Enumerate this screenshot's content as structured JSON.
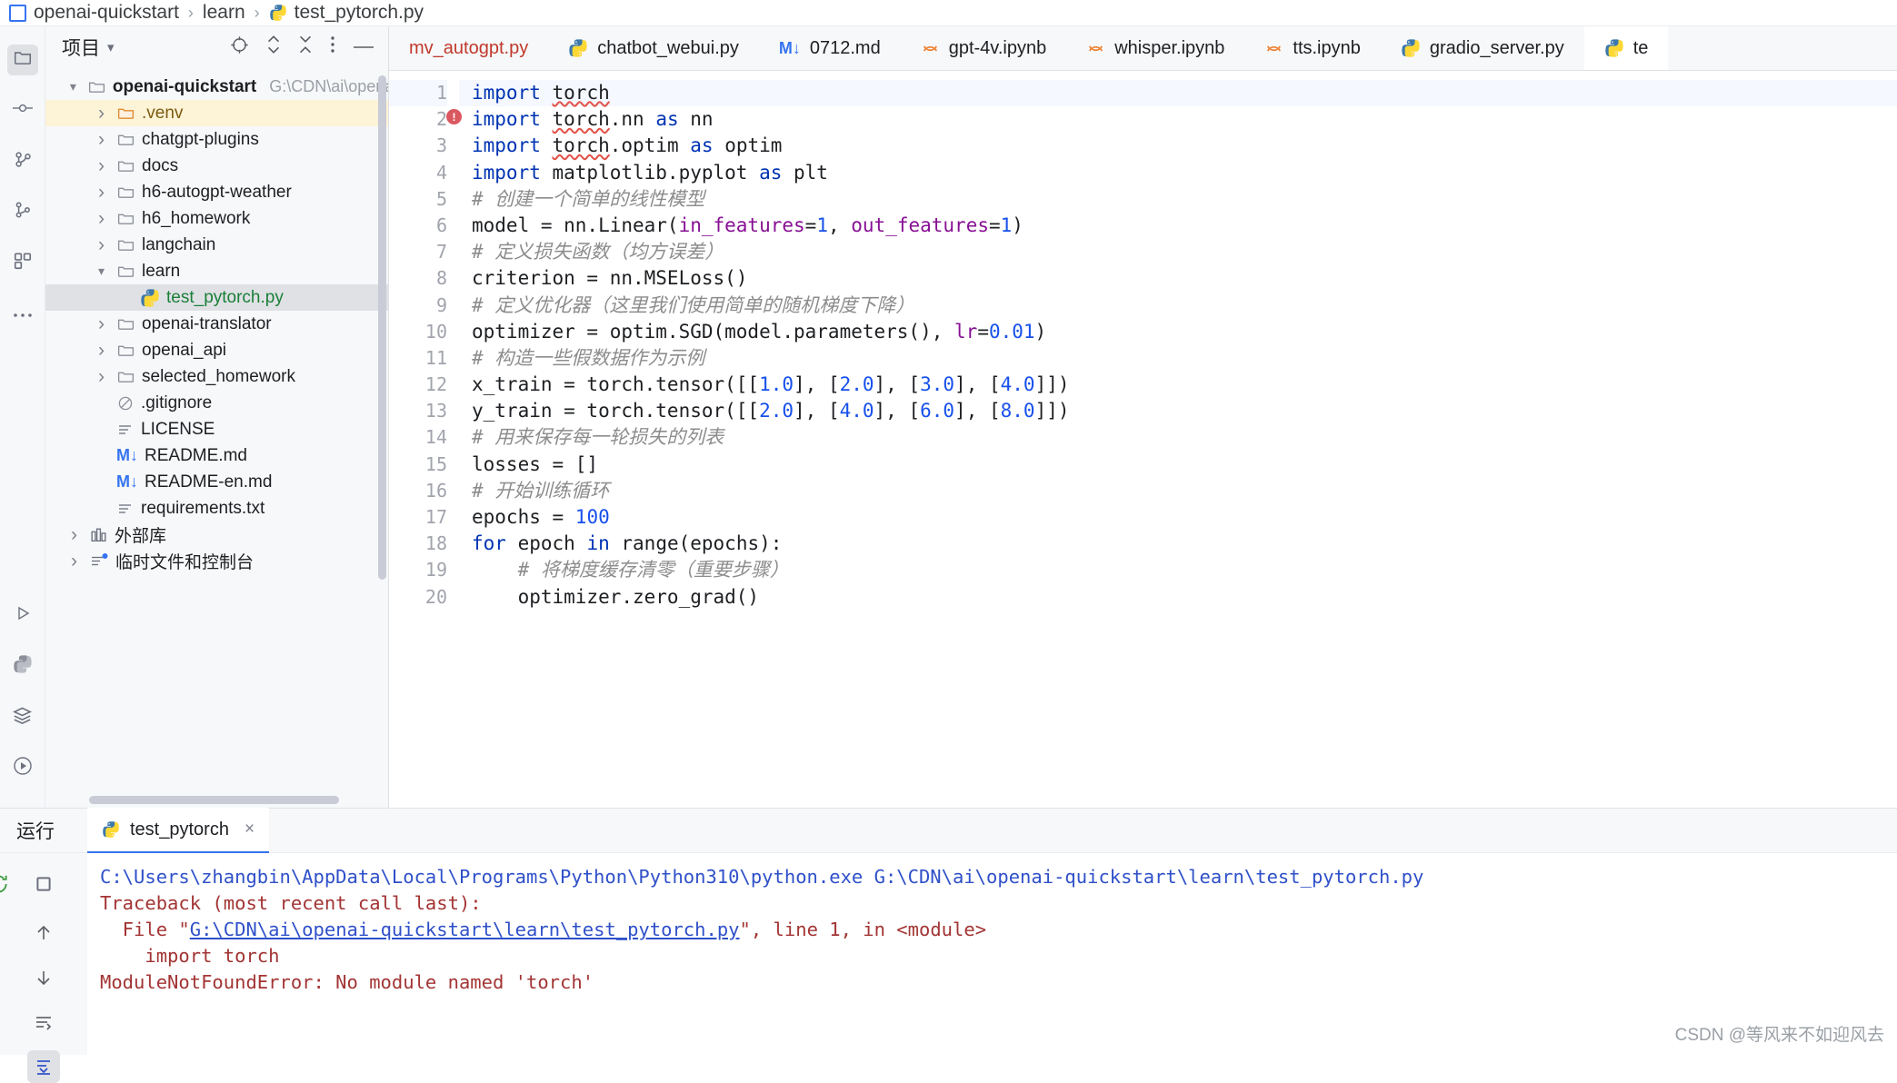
{
  "breadcrumb": {
    "items": [
      "openai-quickstart",
      "learn",
      "test_pytorch.py"
    ],
    "separator": "›"
  },
  "project_panel": {
    "title": "项目",
    "actions": [
      "locate-icon",
      "expand-collapse-icon",
      "collapse-all-icon",
      "more-icon",
      "hide-icon"
    ],
    "tree": [
      {
        "label": "openai-quickstart",
        "path": "G:\\CDN\\ai\\openai-",
        "kind": "folder-root",
        "arrow": "down",
        "indent": 0,
        "state": "expanded",
        "bold": true
      },
      {
        "label": ".venv",
        "path": "",
        "kind": "folder-orange",
        "arrow": "right",
        "indent": 1,
        "state": "highlighted"
      },
      {
        "label": "chatgpt-plugins",
        "path": "",
        "kind": "folder",
        "arrow": "right",
        "indent": 1
      },
      {
        "label": "docs",
        "path": "",
        "kind": "folder",
        "arrow": "right",
        "indent": 1
      },
      {
        "label": "h6-autogpt-weather",
        "path": "",
        "kind": "folder",
        "arrow": "right",
        "indent": 1
      },
      {
        "label": "h6_homework",
        "path": "",
        "kind": "folder",
        "arrow": "right",
        "indent": 1
      },
      {
        "label": "langchain",
        "path": "",
        "kind": "folder",
        "arrow": "right",
        "indent": 1
      },
      {
        "label": "learn",
        "path": "",
        "kind": "folder",
        "arrow": "down",
        "indent": 1,
        "state": "expanded"
      },
      {
        "label": "test_pytorch.py",
        "path": "",
        "kind": "python",
        "arrow": "none",
        "indent": 2,
        "state": "selected"
      },
      {
        "label": "openai-translator",
        "path": "",
        "kind": "folder",
        "arrow": "right",
        "indent": 1
      },
      {
        "label": "openai_api",
        "path": "",
        "kind": "folder",
        "arrow": "right",
        "indent": 1
      },
      {
        "label": "selected_homework",
        "path": "",
        "kind": "folder",
        "arrow": "right",
        "indent": 1
      },
      {
        "label": ".gitignore",
        "path": "",
        "kind": "gitignore",
        "arrow": "none",
        "indent": 1
      },
      {
        "label": "LICENSE",
        "path": "",
        "kind": "text",
        "arrow": "none",
        "indent": 1
      },
      {
        "label": "README.md",
        "path": "",
        "kind": "markdown",
        "arrow": "none",
        "indent": 1
      },
      {
        "label": "README-en.md",
        "path": "",
        "kind": "markdown",
        "arrow": "none",
        "indent": 1
      },
      {
        "label": "requirements.txt",
        "path": "",
        "kind": "text",
        "arrow": "none",
        "indent": 1
      },
      {
        "label": "外部库",
        "path": "",
        "kind": "library",
        "arrow": "right",
        "indent": 0
      },
      {
        "label": "临时文件和控制台",
        "path": "",
        "kind": "scratch",
        "arrow": "right",
        "indent": 0
      }
    ]
  },
  "editor": {
    "tabs": [
      {
        "label": "mv_autogpt.py",
        "icon": "none",
        "color": "red",
        "active": false
      },
      {
        "label": "chatbot_webui.py",
        "icon": "python",
        "color": "normal",
        "active": false
      },
      {
        "label": "0712.md",
        "icon": "markdown",
        "color": "normal",
        "active": false
      },
      {
        "label": "gpt-4v.ipynb",
        "icon": "jupyter",
        "color": "normal",
        "active": false
      },
      {
        "label": "whisper.ipynb",
        "icon": "jupyter",
        "color": "normal",
        "active": false
      },
      {
        "label": "tts.ipynb",
        "icon": "jupyter",
        "color": "normal",
        "active": false
      },
      {
        "label": "gradio_server.py",
        "icon": "python",
        "color": "normal",
        "active": false
      },
      {
        "label": "te",
        "icon": "python",
        "color": "normal",
        "active": true
      }
    ],
    "line_numbers": [
      1,
      2,
      3,
      4,
      5,
      6,
      7,
      8,
      9,
      10,
      11,
      12,
      13,
      14,
      15,
      16,
      17,
      18,
      19,
      20
    ],
    "lines": [
      [
        {
          "t": "import",
          "c": "kw"
        },
        {
          "t": " ",
          "c": "id"
        },
        {
          "t": "torch",
          "c": "err"
        }
      ],
      [
        {
          "t": "import",
          "c": "kw"
        },
        {
          "t": " ",
          "c": "id"
        },
        {
          "t": "torch",
          "c": "err"
        },
        {
          "t": ".nn ",
          "c": "id"
        },
        {
          "t": "as",
          "c": "kw"
        },
        {
          "t": " nn",
          "c": "id"
        }
      ],
      [
        {
          "t": "import",
          "c": "kw"
        },
        {
          "t": " ",
          "c": "id"
        },
        {
          "t": "torch",
          "c": "err"
        },
        {
          "t": ".optim ",
          "c": "id"
        },
        {
          "t": "as",
          "c": "kw"
        },
        {
          "t": " optim",
          "c": "id"
        }
      ],
      [
        {
          "t": "import",
          "c": "kw"
        },
        {
          "t": " matplotlib.pyplot ",
          "c": "id"
        },
        {
          "t": "as",
          "c": "kw"
        },
        {
          "t": " plt",
          "c": "id"
        }
      ],
      [
        {
          "t": "# 创建一个简单的线性模型",
          "c": "cmt"
        }
      ],
      [
        {
          "t": "model = nn.Linear(",
          "c": "id"
        },
        {
          "t": "in_features",
          "c": "kwarg"
        },
        {
          "t": "=",
          "c": "id"
        },
        {
          "t": "1",
          "c": "num"
        },
        {
          "t": ", ",
          "c": "id"
        },
        {
          "t": "out_features",
          "c": "kwarg"
        },
        {
          "t": "=",
          "c": "id"
        },
        {
          "t": "1",
          "c": "num"
        },
        {
          "t": ")",
          "c": "id"
        }
      ],
      [
        {
          "t": "# 定义损失函数（均方误差）",
          "c": "cmt"
        }
      ],
      [
        {
          "t": "criterion = nn.MSELoss()",
          "c": "id"
        }
      ],
      [
        {
          "t": "# 定义优化器（这里我们使用简单的随机梯度下降）",
          "c": "cmt"
        }
      ],
      [
        {
          "t": "optimizer = optim.SGD(model.parameters(), ",
          "c": "id"
        },
        {
          "t": "lr",
          "c": "kwarg"
        },
        {
          "t": "=",
          "c": "id"
        },
        {
          "t": "0.01",
          "c": "num"
        },
        {
          "t": ")",
          "c": "id"
        }
      ],
      [
        {
          "t": "# 构造一些假数据作为示例",
          "c": "cmt"
        }
      ],
      [
        {
          "t": "x_train = torch.tensor([[",
          "c": "id"
        },
        {
          "t": "1.0",
          "c": "num"
        },
        {
          "t": "], [",
          "c": "id"
        },
        {
          "t": "2.0",
          "c": "num"
        },
        {
          "t": "], [",
          "c": "id"
        },
        {
          "t": "3.0",
          "c": "num"
        },
        {
          "t": "], [",
          "c": "id"
        },
        {
          "t": "4.0",
          "c": "num"
        },
        {
          "t": "]])",
          "c": "id"
        }
      ],
      [
        {
          "t": "y_train = torch.tensor([[",
          "c": "id"
        },
        {
          "t": "2.0",
          "c": "num"
        },
        {
          "t": "], [",
          "c": "id"
        },
        {
          "t": "4.0",
          "c": "num"
        },
        {
          "t": "], [",
          "c": "id"
        },
        {
          "t": "6.0",
          "c": "num"
        },
        {
          "t": "], [",
          "c": "id"
        },
        {
          "t": "8.0",
          "c": "num"
        },
        {
          "t": "]])",
          "c": "id"
        }
      ],
      [
        {
          "t": "# 用来保存每一轮损失的列表",
          "c": "cmt"
        }
      ],
      [
        {
          "t": "losses = []",
          "c": "id"
        }
      ],
      [
        {
          "t": "# 开始训练循环",
          "c": "cmt"
        }
      ],
      [
        {
          "t": "epochs = ",
          "c": "id"
        },
        {
          "t": "100",
          "c": "num"
        }
      ],
      [
        {
          "t": "for",
          "c": "kw"
        },
        {
          "t": " epoch ",
          "c": "id"
        },
        {
          "t": "in",
          "c": "kw"
        },
        {
          "t": " range(epochs):",
          "c": "id"
        }
      ],
      [
        {
          "t": "    # 将梯度缓存清零（重要步骤）",
          "c": "cmt"
        }
      ],
      [
        {
          "t": "    optimizer.zero_grad()",
          "c": "id"
        }
      ]
    ]
  },
  "run_panel": {
    "title": "运行",
    "tab_label": "test_pytorch",
    "tab_close": "×",
    "toolbar": [
      "rerun-icon",
      "stop-icon",
      "more-icon"
    ],
    "side_actions": [
      "rerun-icon",
      "stop-icon",
      "more-icon",
      "up-arrow-icon",
      "down-arrow-icon",
      "wrap-text-icon",
      "scroll-to-end-icon"
    ],
    "console": [
      {
        "text": "C:\\Users\\zhangbin\\AppData\\Local\\Programs\\Python\\Python310\\python.exe G:\\CDN\\ai\\openai-quickstart\\learn\\test_pytorch.py",
        "style": "cmd"
      },
      {
        "text": "Traceback (most recent call last):",
        "style": "err"
      },
      {
        "pre": "  File \"",
        "link": "G:\\CDN\\ai\\openai-quickstart\\learn\\test_pytorch.py",
        "post": "\", line 1, in <module>",
        "style": "err"
      },
      {
        "text": "    import torch",
        "style": "err"
      },
      {
        "text": "ModuleNotFoundError: No module named 'torch'",
        "style": "err"
      }
    ]
  },
  "rail": {
    "top": [
      "project-folder-icon",
      "commit-icon",
      "pull-requests-icon",
      "branches-icon",
      "structure-icon",
      "more-tools-icon"
    ],
    "bottom": [
      "run-icon",
      "python-console-icon",
      "services-icon",
      "debug-icon"
    ]
  },
  "watermark": "CSDN @等风来不如迎风去",
  "colors": {
    "accent": "#3574f0",
    "selection": "#dfe1e5",
    "highlight": "#fdf3d7",
    "error_red": "#a33434",
    "keyword_blue": "#0033b3",
    "python_green": "#1a7f37"
  }
}
